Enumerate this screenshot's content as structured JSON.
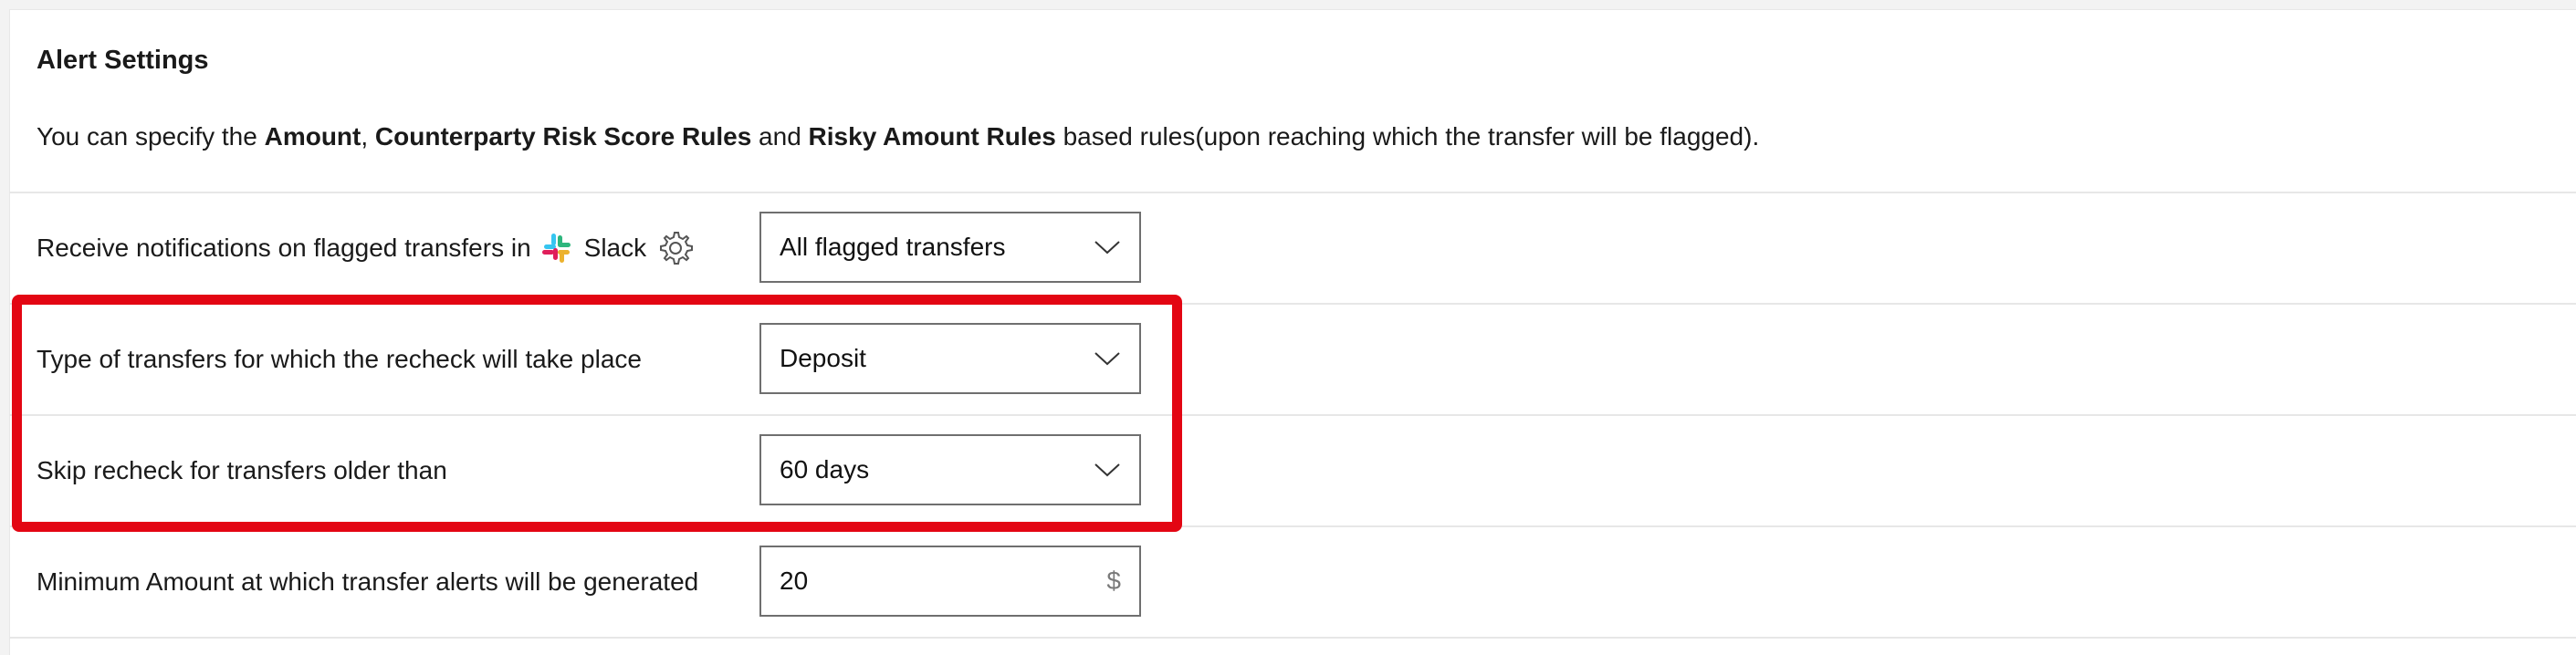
{
  "section": {
    "title": "Alert Settings",
    "description": {
      "prefix": "You can specify the ",
      "bold_1": "Amount",
      "sep_1": ", ",
      "bold_2": "Counterparty Risk Score Rules",
      "sep_2": " and ",
      "bold_3": "Risky Amount Rules",
      "suffix": " based rules(upon reaching which the transfer will be flagged)."
    }
  },
  "rows": {
    "notifications": {
      "label": "Receive notifications on flagged transfers in",
      "app_name": "Slack",
      "selected": "All flagged transfers"
    },
    "transfer_type": {
      "label": "Type of transfers for which the recheck will take place",
      "selected": "Deposit"
    },
    "skip_recheck": {
      "label": "Skip recheck for transfers older than",
      "selected": "60 days"
    },
    "min_amount": {
      "label": "Minimum Amount at which transfer alerts will be generated",
      "value": "20",
      "unit": "$"
    }
  },
  "colors": {
    "highlight": "#e30613",
    "slack_blue": "#36C5F0",
    "slack_green": "#2EB67D",
    "slack_yellow": "#ECB22E",
    "slack_red": "#E01E5A"
  },
  "icons": {
    "slack": "slack-logo-icon",
    "settings": "gear-icon",
    "dropdown": "chevron-down-icon"
  }
}
